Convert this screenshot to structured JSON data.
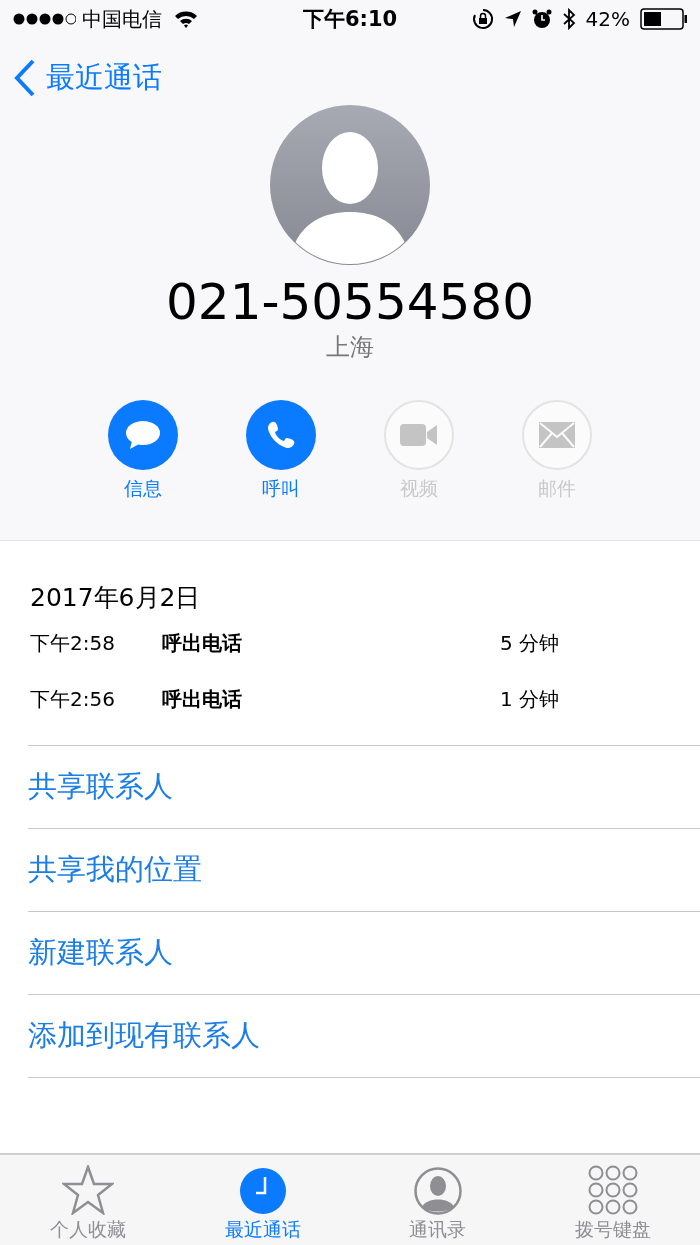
{
  "status_bar": {
    "carrier": "中国电信",
    "time": "下午6:10",
    "battery": "42%"
  },
  "nav": {
    "back": "最近通话"
  },
  "contact": {
    "number": "021-50554580",
    "location": "上海"
  },
  "actions": [
    {
      "kind": "message",
      "label": "信息",
      "disabled": false
    },
    {
      "kind": "call",
      "label": "呼叫",
      "disabled": false
    },
    {
      "kind": "video",
      "label": "视频",
      "disabled": true
    },
    {
      "kind": "mail",
      "label": "邮件",
      "disabled": true
    }
  ],
  "call_log": {
    "date": "2017年6月2日",
    "rows": [
      {
        "time": "下午2:58",
        "type": "呼出电话",
        "duration": "5 分钟"
      },
      {
        "time": "下午2:56",
        "type": "呼出电话",
        "duration": "1 分钟"
      }
    ]
  },
  "options": [
    "共享联系人",
    "共享我的位置",
    "新建联系人",
    "添加到现有联系人"
  ],
  "tabs": [
    {
      "kind": "favorites",
      "label": "个人收藏",
      "selected": false
    },
    {
      "kind": "recents",
      "label": "最近通话",
      "selected": true
    },
    {
      "kind": "contacts",
      "label": "通讯录",
      "selected": false
    },
    {
      "kind": "keypad",
      "label": "拨号键盘",
      "selected": false
    }
  ]
}
